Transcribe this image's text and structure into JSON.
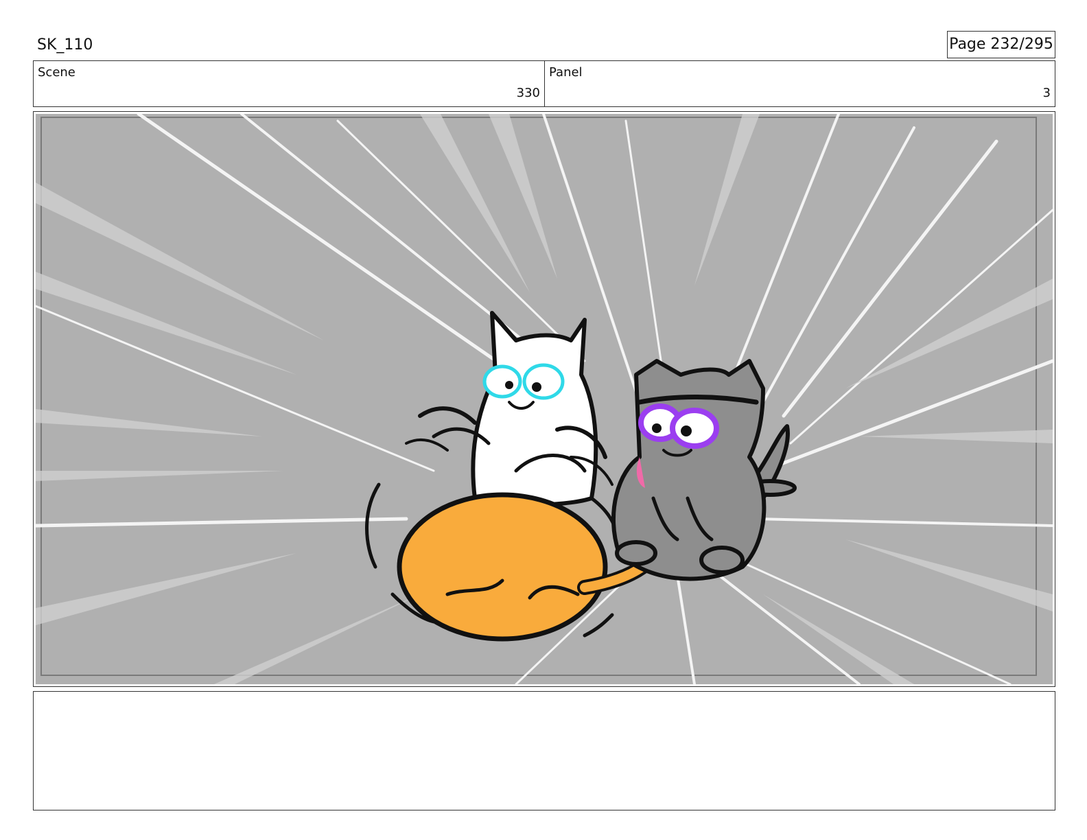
{
  "header": {
    "project_title": "SK_110",
    "page_indicator": "Page 232/295"
  },
  "info": {
    "scene_label": "Scene",
    "scene_value": "330",
    "panel_label": "Panel",
    "panel_value": "3"
  },
  "notes": {
    "text": ""
  },
  "colors": {
    "frame_background": "#b0b0b0",
    "ball_orange": "#f9ab3c",
    "white_cat_eyes": "#2fd9e8",
    "grey_cat_body": "#8e8e8e",
    "grey_cat_eyes": "#9b3ef0",
    "tongue_pink": "#f06aa8"
  }
}
